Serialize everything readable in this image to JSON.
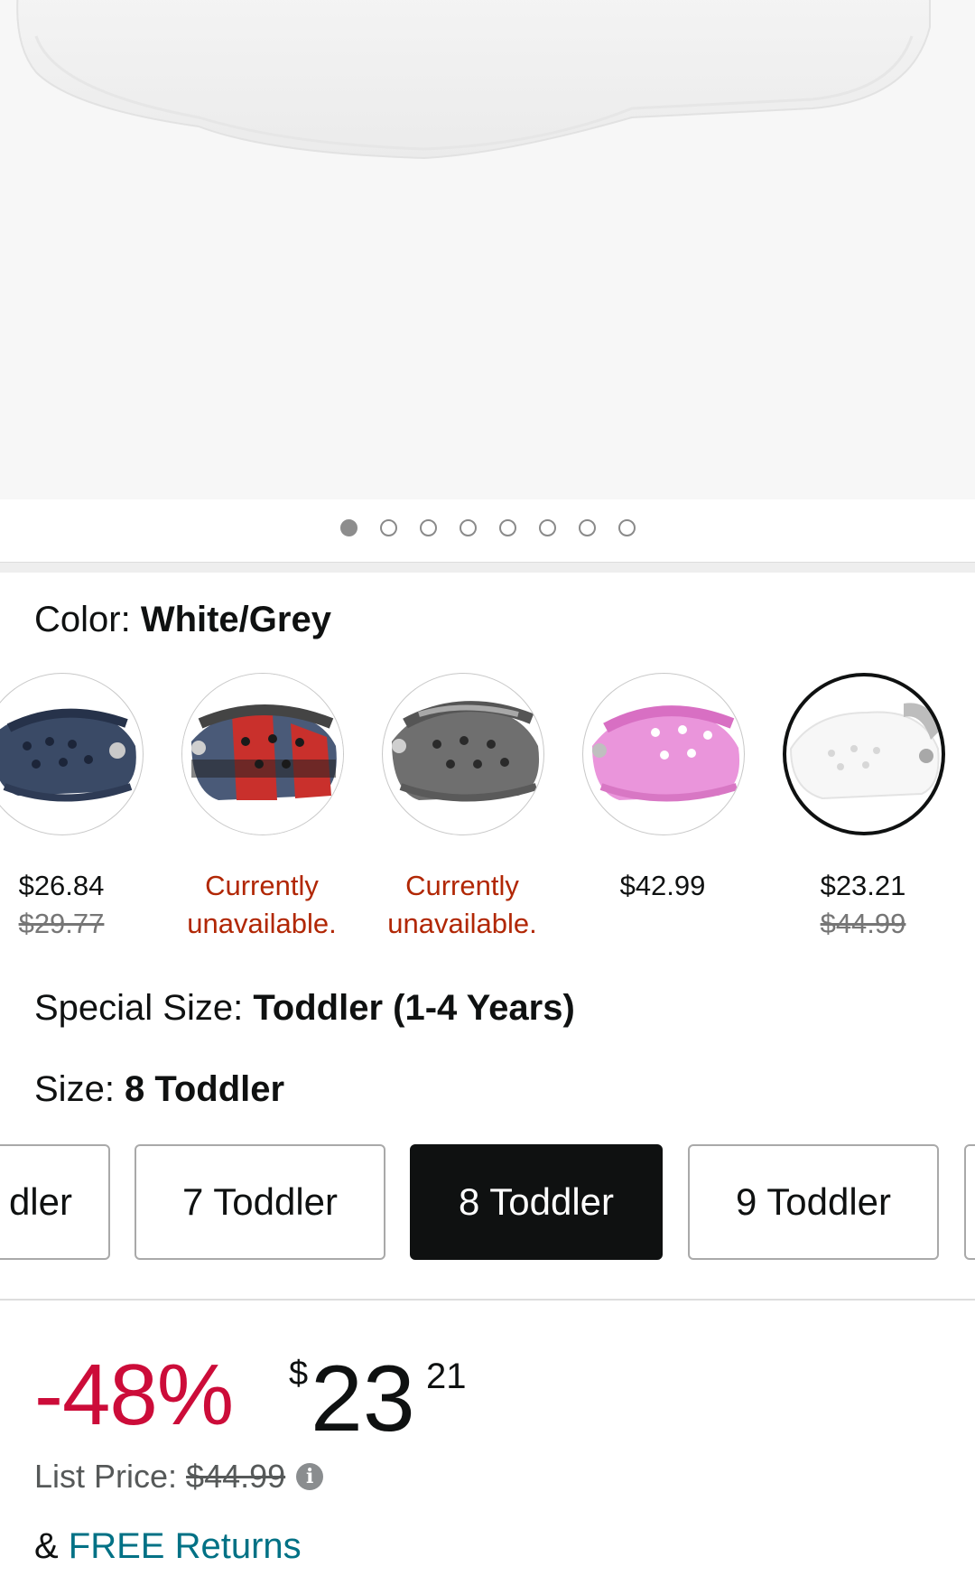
{
  "gallery": {
    "image_name": "white-grey-clog-photo",
    "dots_total": 8,
    "active_index": 0
  },
  "color": {
    "label": "Color: ",
    "value": "White/Grey",
    "swatches": [
      {
        "name": "navy",
        "price": "$26.84",
        "old_price": "$29.77",
        "available": true,
        "selected": false,
        "fill": "#3a4a66"
      },
      {
        "name": "red-plaid",
        "price": "Currently unavailable.",
        "old_price": "",
        "available": false,
        "selected": false,
        "fill": "#c9302c"
      },
      {
        "name": "grey",
        "price": "Currently unavailable.",
        "old_price": "",
        "available": false,
        "selected": false,
        "fill": "#6f6f6f"
      },
      {
        "name": "pink",
        "price": "$42.99",
        "old_price": "",
        "available": true,
        "selected": false,
        "fill": "#e98fd6"
      },
      {
        "name": "white-grey",
        "price": "$23.21",
        "old_price": "$44.99",
        "available": true,
        "selected": true,
        "fill": "#f6f6f6"
      }
    ]
  },
  "special_size": {
    "label": "Special Size: ",
    "value": "Toddler (1-4 Years)"
  },
  "size": {
    "label": "Size: ",
    "value": "8 Toddler",
    "options": [
      {
        "label": "dler",
        "selected": false
      },
      {
        "label": "7 Toddler",
        "selected": false
      },
      {
        "label": "8 Toddler",
        "selected": true
      },
      {
        "label": "9 Toddler",
        "selected": false
      },
      {
        "label": "",
        "selected": false
      }
    ]
  },
  "pricing": {
    "discount": "-48%",
    "currency": "$",
    "whole": "23",
    "fraction": "21",
    "list_price_label": "List Price: ",
    "list_price": "$44.99",
    "info_icon": "info-icon"
  },
  "returns": {
    "prefix": "& ",
    "link": "FREE Returns"
  },
  "colors": {
    "accent_red": "#cc0c39",
    "link_teal": "#007185",
    "unavailable": "#b12704"
  }
}
